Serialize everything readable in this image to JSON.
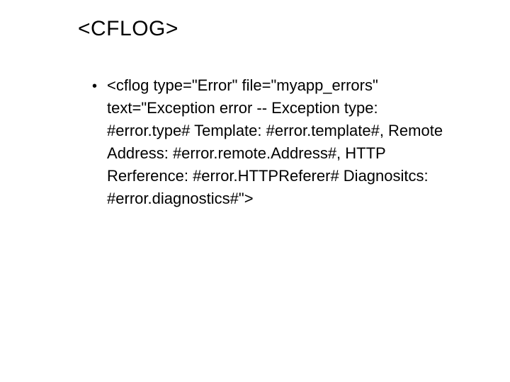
{
  "title": "<CFLOG>",
  "bullet": {
    "marker": "•",
    "text": "<cflog type=\"Error\" file=\"myapp_errors\" text=\"Exception error -- Exception type: #error.type# Template: #error.template#, Remote Address: #error.remote.Address#, HTTP Rerference: #error.HTTPReferer# Diagnositcs: #error.diagnostics#\">"
  }
}
